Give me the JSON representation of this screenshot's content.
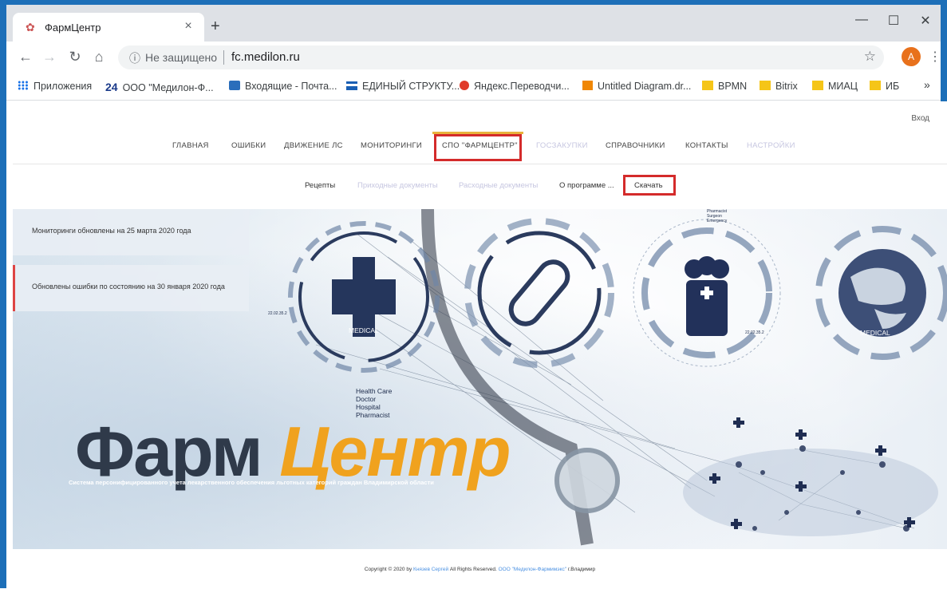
{
  "browser": {
    "tab_title": "ФармЦентр",
    "tab_close": "×",
    "new_tab": "+",
    "insecure_label": "Не защищено",
    "url": "fc.medilon.ru",
    "avatar_letter": "A",
    "window": {
      "minimize": "—",
      "maximize": "☐",
      "close": "✕"
    },
    "nav": {
      "back": "←",
      "forward": "→",
      "reload": "↻",
      "home": "⌂"
    },
    "bookmarks": [
      {
        "label": "Приложения",
        "icon": "apps-icon"
      },
      {
        "label": "ООО \"Медилон-Ф...",
        "icon": "24-icon",
        "prefix": "24"
      },
      {
        "label": "Входящие - Почта...",
        "icon": "mail-icon"
      },
      {
        "label": "ЕДИНЫЙ СТРУКТУ...",
        "icon": "menu-icon"
      },
      {
        "label": "Яндекс.Переводчи...",
        "icon": "yandex-icon"
      },
      {
        "label": "Untitled Diagram.dr...",
        "icon": "drawio-icon"
      },
      {
        "label": "BPMN",
        "icon": "folder-icon"
      },
      {
        "label": "Bitrix",
        "icon": "folder-icon"
      },
      {
        "label": "МИАЦ",
        "icon": "folder-icon"
      },
      {
        "label": "ИБ",
        "icon": "folder-icon"
      }
    ],
    "more_bookmarks": "»"
  },
  "site": {
    "login": "Вход",
    "main_nav": [
      {
        "label": "ГЛАВНАЯ",
        "dim": false
      },
      {
        "label": "ОШИБКИ",
        "dim": false
      },
      {
        "label": "ДВИЖЕНИЕ ЛС",
        "dim": false
      },
      {
        "label": "МОНИТОРИНГИ",
        "dim": false
      },
      {
        "label": "СПО \"ФАРМЦЕНТР\"",
        "dim": false
      },
      {
        "label": "ГОСЗАКУПКИ",
        "dim": true
      },
      {
        "label": "СПРАВОЧНИКИ",
        "dim": false
      },
      {
        "label": "КОНТАКТЫ",
        "dim": false
      },
      {
        "label": "НАСТРОЙКИ",
        "dim": true
      }
    ],
    "sub_nav": [
      {
        "label": "Рецепты",
        "dim": false
      },
      {
        "label": "Приходные документы",
        "dim": true
      },
      {
        "label": "Расходные документы",
        "dim": true
      },
      {
        "label": "О программе ...",
        "dim": false
      },
      {
        "label": "Скачать",
        "dim": false
      }
    ],
    "notices": [
      "Мониторинги обновлены на 25 марта 2020 года",
      "Обновлены ошибки по состоянию на 30 января 2020 года"
    ],
    "hero": {
      "title_main": "Фарм",
      "title_accent": "Центр",
      "subtitle": "Система персонифицированного учета лекарственного обеспечения льготных категорий граждан Владимирской области",
      "list": [
        "Health Care",
        "Doctor",
        "Hospital",
        "Pharmacist"
      ],
      "medical_label": "MEDICAL",
      "code_label": "22.02.35.2",
      "mini_list": [
        "Pharmacist",
        "Surgeon",
        "Emergency"
      ]
    },
    "footer": {
      "prefix": "Copyright © 2020 by",
      "author": "Князев Сергей",
      "middle": "All Rights Reserved.",
      "company": "ООО \"Медилон-Фармимэкс\"",
      "city": "г.Владимир"
    }
  }
}
